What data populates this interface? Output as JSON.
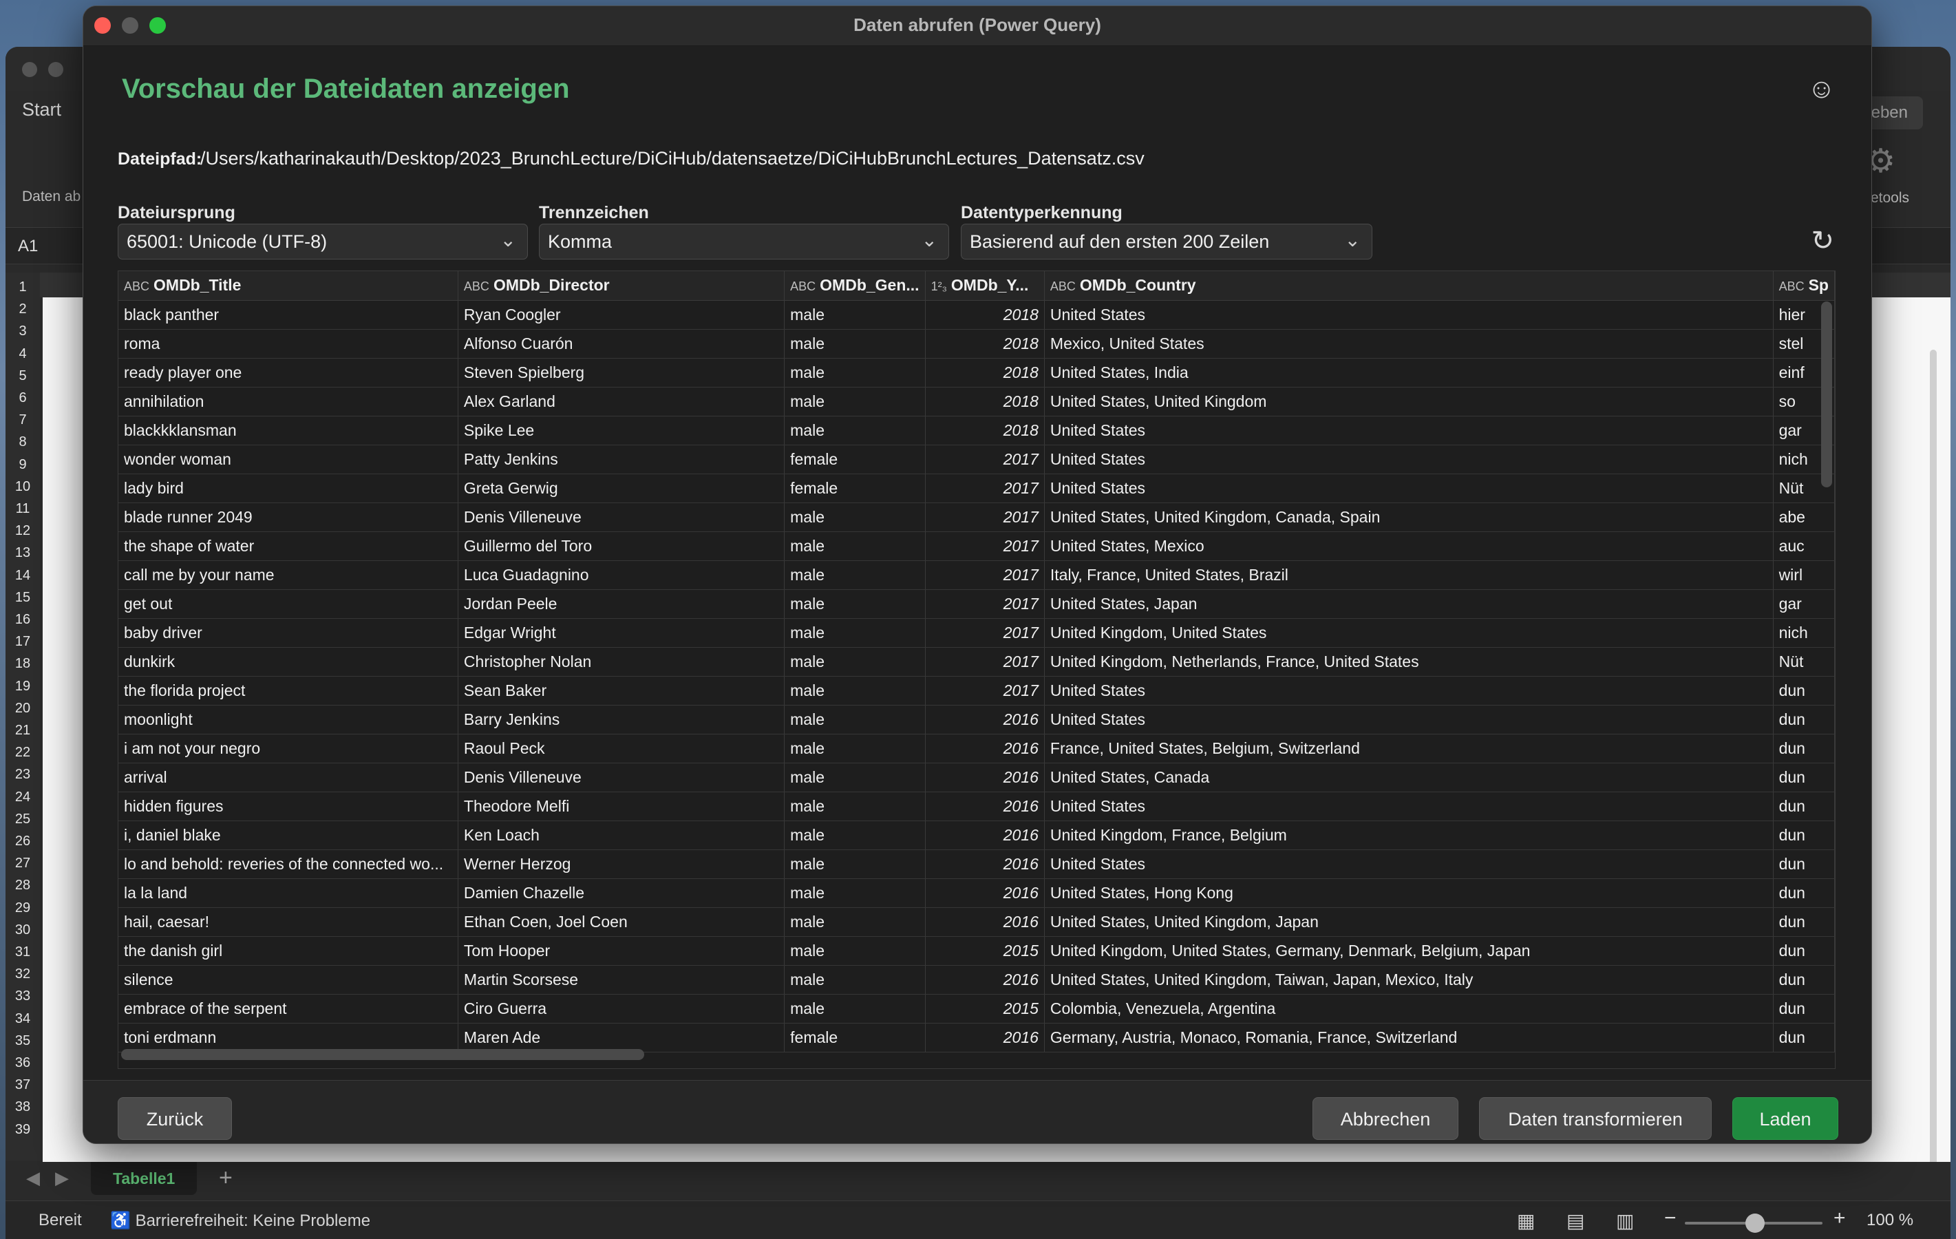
{
  "excel": {
    "ribbon_tab": "Start",
    "ribbon_left_label": "Daten ab… C",
    "ribbon_right_button": "igeben",
    "ribbon_right_label": "setools",
    "name_box": "A1",
    "row_numbers": [
      "1",
      "2",
      "3",
      "4",
      "5",
      "6",
      "7",
      "8",
      "9",
      "10",
      "11",
      "12",
      "13",
      "14",
      "15",
      "16",
      "17",
      "18",
      "19",
      "20",
      "21",
      "22",
      "23",
      "24",
      "25",
      "26",
      "27",
      "28",
      "29",
      "30",
      "31",
      "32",
      "33",
      "34",
      "35",
      "36",
      "37",
      "38",
      "39"
    ],
    "sheet_tab": "Tabelle1",
    "status_ready": "Bereit",
    "status_accessibility": "Barrierefreiheit: Keine Probleme",
    "zoom": "100 %"
  },
  "dialog": {
    "window_title": "Daten abrufen (Power Query)",
    "heading": "Vorschau der Dateidaten anzeigen",
    "path_label": "Dateipfad:",
    "path_value": "/Users/katharinakauth/Desktop/2023_BrunchLecture/DiCiHub/datensaetze/DiCiHubBrunchLectures_Datensatz.csv",
    "origin_label": "Dateiursprung",
    "origin_value": "65001: Unicode (UTF-8)",
    "delimiter_label": "Trennzeichen",
    "delimiter_value": "Komma",
    "detection_label": "Datentyperkennung",
    "detection_value": "Basierend auf den ersten 200 Zeilen",
    "buttons": {
      "back": "Zurück",
      "cancel": "Abbrechen",
      "transform": "Daten transformieren",
      "load": "Laden"
    }
  },
  "table": {
    "columns": [
      {
        "type_icon": "ABC",
        "name": "OMDb_Title"
      },
      {
        "type_icon": "ABC",
        "name": "OMDb_Director"
      },
      {
        "type_icon": "ABC",
        "name": "OMDb_Gen..."
      },
      {
        "type_icon": "1²₃",
        "name": "OMDb_Y..."
      },
      {
        "type_icon": "ABC",
        "name": "OMDb_Country"
      },
      {
        "type_icon": "ABC",
        "name": "Sp"
      }
    ],
    "rows": [
      [
        "black panther",
        "Ryan Coogler",
        "male",
        "2018",
        "United States",
        "hier"
      ],
      [
        "roma",
        "Alfonso Cuarón",
        "male",
        "2018",
        "Mexico, United States",
        "stel"
      ],
      [
        "ready player one",
        "Steven Spielberg",
        " male",
        "2018",
        "United States, India",
        "einf"
      ],
      [
        "annihilation",
        "Alex Garland",
        "male",
        "2018",
        "United States, United Kingdom",
        "so"
      ],
      [
        "blackkklansman",
        "Spike Lee",
        "male",
        "2018",
        "United States",
        "gar"
      ],
      [
        "wonder woman",
        "Patty Jenkins",
        "female",
        "2017",
        "United States",
        "nich"
      ],
      [
        "lady bird",
        "Greta Gerwig",
        "female",
        "2017",
        "United States",
        "Nüt"
      ],
      [
        "blade runner 2049",
        "Denis Villeneuve",
        "male",
        "2017",
        "United States, United Kingdom, Canada, Spain",
        "abe"
      ],
      [
        "the shape of water",
        "Guillermo del Toro",
        "male",
        "2017",
        "United States, Mexico",
        "auc"
      ],
      [
        "call me by your name",
        "Luca Guadagnino",
        "male",
        "2017",
        "Italy, France, United States, Brazil",
        "wirl"
      ],
      [
        "get out",
        "Jordan Peele",
        "male",
        "2017",
        "United States, Japan",
        "gar"
      ],
      [
        "baby driver",
        "Edgar Wright",
        "male",
        "2017",
        "United Kingdom, United States",
        "nich"
      ],
      [
        "dunkirk",
        "Christopher Nolan",
        " male",
        "2017",
        "United Kingdom, Netherlands, France, United States",
        "Nüt"
      ],
      [
        "the florida project",
        "Sean Baker",
        "male",
        "2017",
        "United States",
        "dun"
      ],
      [
        "moonlight",
        "Barry Jenkins",
        "male",
        "2016",
        "United States",
        "dun"
      ],
      [
        "i am not your negro",
        "Raoul Peck",
        "male",
        "2016",
        "France, United States, Belgium, Switzerland",
        "dun"
      ],
      [
        "arrival",
        "Denis Villeneuve",
        "male",
        "2016",
        "United States, Canada",
        "dun"
      ],
      [
        "hidden figures",
        "Theodore Melfi",
        "male",
        "2016",
        "United States",
        "dun"
      ],
      [
        "i, daniel blake",
        "Ken Loach",
        " male",
        "2016",
        "United Kingdom, France, Belgium",
        "dun"
      ],
      [
        "lo and behold: reveries of the connected wo...",
        "Werner Herzog",
        "male",
        "2016",
        "United States",
        "dun"
      ],
      [
        "la la land",
        "Damien Chazelle",
        "male",
        "2016",
        "United States, Hong Kong",
        "dun"
      ],
      [
        "hail, caesar!",
        "Ethan Coen, Joel Coen",
        "male",
        "2016",
        "United States, United Kingdom, Japan",
        "dun"
      ],
      [
        "the danish girl",
        "Tom Hooper",
        "male",
        "2015",
        "United Kingdom, United States, Germany, Denmark, Belgium, Japan",
        "dun"
      ],
      [
        "silence",
        "Martin Scorsese",
        "male",
        "2016",
        "United States, United Kingdom, Taiwan, Japan, Mexico, Italy",
        "dun"
      ],
      [
        "embrace of the serpent",
        "Ciro Guerra",
        "male",
        "2015",
        "Colombia, Venezuela, Argentina",
        "dun"
      ],
      [
        "toni erdmann",
        "Maren Ade",
        "female",
        "2016",
        "Germany, Austria, Monaco, Romania, France, Switzerland",
        "dun"
      ]
    ]
  },
  "colors": {
    "accent_green": "#5cb97a",
    "primary_button": "#1f8a3f"
  }
}
